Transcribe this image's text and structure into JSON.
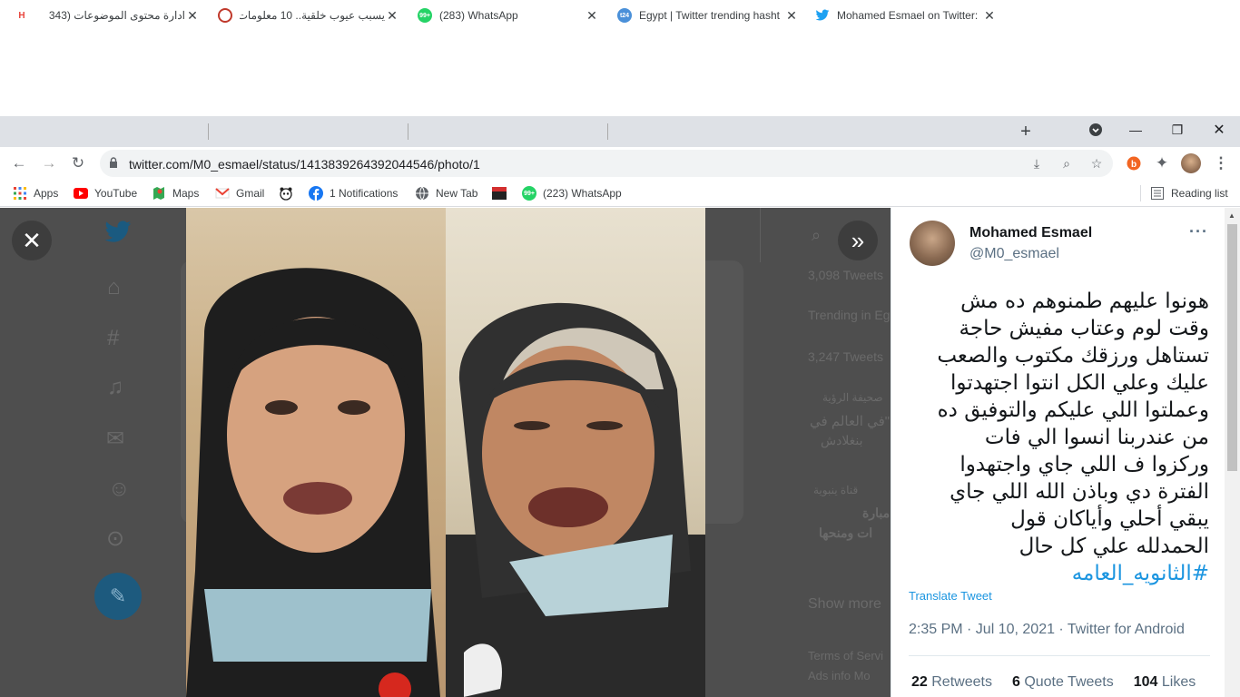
{
  "tabs": [
    {
      "title": "ادارة محتوى الموضوعات (343",
      "icon": "h-icon",
      "color": "#e8453c"
    },
    {
      "title": "يسبب عيوب خلقية.. 10 معلومات",
      "icon": "site-icon",
      "color": "#c0392b"
    },
    {
      "title": "(283) WhatsApp",
      "icon": "whatsapp-icon",
      "color": "#25d366"
    },
    {
      "title": "Egypt | Twitter trending hasht",
      "icon": "t24-icon",
      "color": "#4a90d9"
    },
    {
      "title": "Mohamed Esmael on Twitter:",
      "icon": "twitter-icon",
      "color": "#1da1f2"
    }
  ],
  "address_bar": {
    "url": "twitter.com/M0_esmael/status/1413839264392044546/photo/1"
  },
  "bookmarks": [
    {
      "label": "Apps",
      "icon": "apps-grid-icon"
    },
    {
      "label": "YouTube",
      "icon": "youtube-icon"
    },
    {
      "label": "Maps",
      "icon": "maps-icon"
    },
    {
      "label": "Gmail",
      "icon": "gmail-icon"
    },
    {
      "label": "",
      "icon": "panda-icon"
    },
    {
      "label": "1 Notifications",
      "icon": "facebook-icon"
    },
    {
      "label": "New Tab",
      "icon": "globe-icon"
    },
    {
      "label": "",
      "icon": "news-icon"
    },
    {
      "label": "(223) WhatsApp",
      "icon": "whatsapp-icon"
    }
  ],
  "reading_list": "Reading list",
  "background_ghost": {
    "tweets_1": "3,098 Tweets",
    "trending": "Trending in Eg",
    "tweets_2": "3,247 Tweets",
    "news_1": "صحيفة الرؤية",
    "news_2": "في العالم في\"",
    "news_3": "بنغلادش",
    "news_4": "قناة ينبوية",
    "news_5": "مبارة",
    "news_6": "ات ومنحها",
    "show_more": "Show more",
    "terms": "Terms of Servi",
    "ads": "Ads info   Mo"
  },
  "tweet": {
    "name": "Mohamed Esmael",
    "handle": "@M0_esmael",
    "text": "هونوا عليهم طمنوهم ده مش\nوقت لوم وعتاب مفيش حاجة\nتستاهل ورزقك مكتوب والصعب\nعليك وعلي الكل انتوا اجتهدتوا\nوعملتوا اللي عليكم والتوفيق ده\nمن عندربنا انسوا الي فات\nوركزوا ف اللي جاي واجتهدوا\nالفترة دي وباذن الله اللي جاي\nيبقي أحلي وأياكان قول\nالحمدلله علي كل حال",
    "hashtag": "#الثانويه_العامه",
    "translate": "Translate Tweet",
    "timestamp": "2:35 PM · Jul 10, 2021 · Twitter for Android",
    "retweets_count": "22",
    "retweets_label": "Retweets",
    "quotes_count": "6",
    "quotes_label": "Quote Tweets",
    "likes_count": "104",
    "likes_label": "Likes"
  }
}
